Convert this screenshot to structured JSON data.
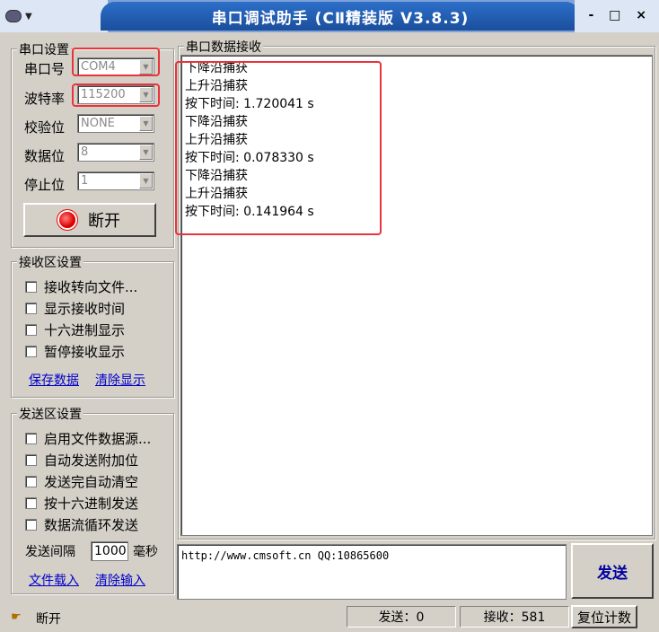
{
  "window": {
    "title": "串口调试助手  (CⅡ精装版 V3.8.3)",
    "controls": "- □ ×"
  },
  "port_settings": {
    "group_title": "串口设置",
    "port_label": "串口号",
    "port_value": "COM4",
    "baud_label": "波特率",
    "baud_value": "115200",
    "parity_label": "校验位",
    "parity_value": "NONE",
    "databits_label": "数据位",
    "databits_value": "8",
    "stopbits_label": "停止位",
    "stopbits_value": "1",
    "disconnect_button": "断开"
  },
  "receive_settings": {
    "group_title": "接收区设置",
    "options": [
      "接收转向文件...",
      "显示接收时间",
      "十六进制显示",
      "暂停接收显示"
    ],
    "save_link": "保存数据",
    "clear_link": "清除显示"
  },
  "send_settings": {
    "group_title": "发送区设置",
    "options": [
      "启用文件数据源...",
      "自动发送附加位",
      "发送完自动清空",
      "按十六进制发送",
      "数据流循环发送"
    ],
    "interval_label": "发送间隔",
    "interval_value": "1000",
    "interval_unit": "毫秒",
    "load_file_link": "文件载入",
    "clear_input_link": "清除输入"
  },
  "receive_area": {
    "group_title": "串口数据接收",
    "lines": [
      "下降沿捕获",
      "上升沿捕获",
      "按下时间: 1.720041 s",
      "下降沿捕获",
      "上升沿捕获",
      "按下时间: 0.078330 s",
      "下降沿捕获",
      "上升沿捕获",
      "按下时间: 0.141964 s"
    ]
  },
  "send_area": {
    "text": "http://www.cmsoft.cn QQ:10865600",
    "send_button": "发送"
  },
  "statusbar": {
    "status": "断开",
    "sent": "发送：0",
    "received": "接收：581",
    "reset_button": "复位计数"
  }
}
